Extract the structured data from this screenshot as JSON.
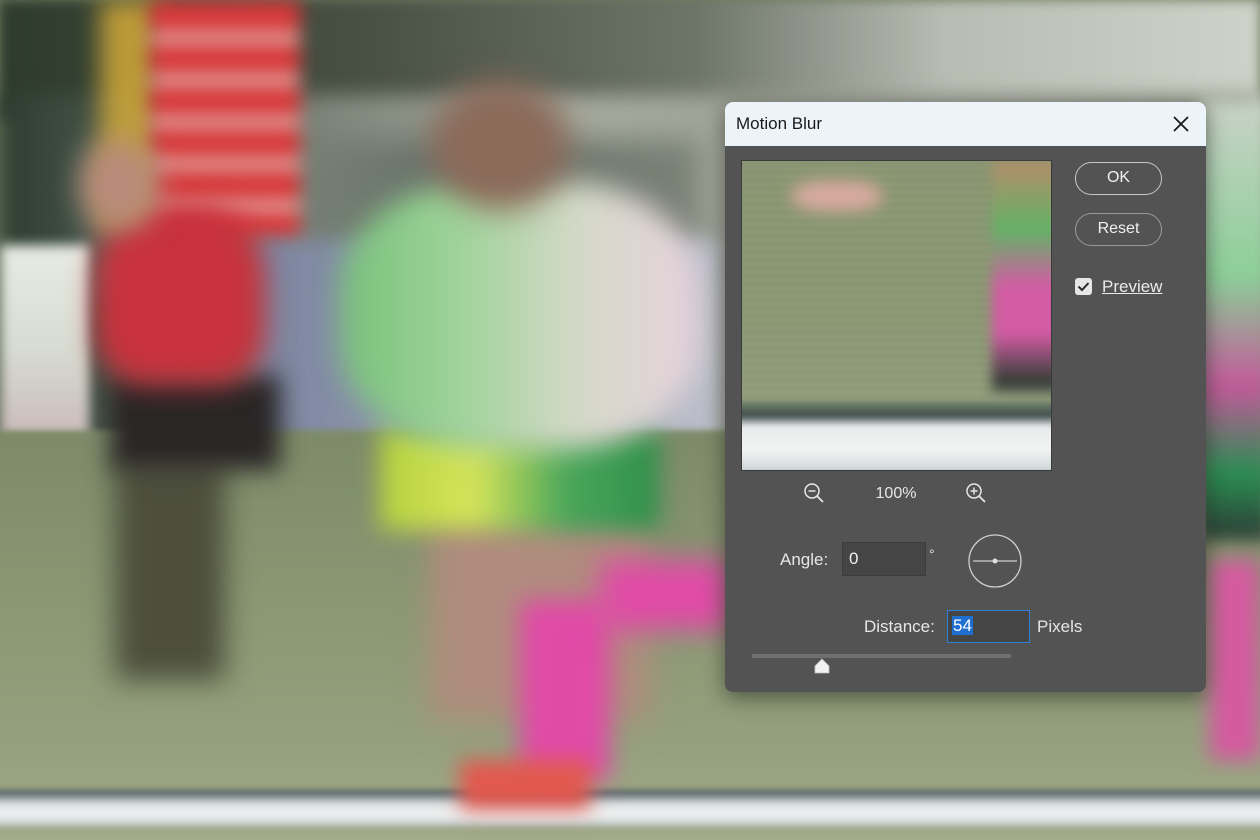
{
  "dialog": {
    "title": "Motion Blur",
    "buttons": {
      "ok": "OK",
      "reset": "Reset"
    },
    "preview": {
      "label": "Preview",
      "checked": true
    },
    "zoom": {
      "level": "100%"
    },
    "angle": {
      "label": "Angle:",
      "value": "0",
      "unit": "°"
    },
    "distance": {
      "label": "Distance:",
      "value": "54",
      "unit": "Pixels",
      "slider_fraction": 0.27
    }
  },
  "icons": [
    "close-icon",
    "zoom-out-icon",
    "zoom-in-icon",
    "checkmark-icon",
    "angle-dial-icon",
    "slider-thumb-icon"
  ],
  "colors": {
    "dialog_bg": "#535353",
    "titlebar_bg": "#ecf3f9",
    "focus_accent": "#2f7fd6",
    "selection": "#1f6fd1"
  }
}
